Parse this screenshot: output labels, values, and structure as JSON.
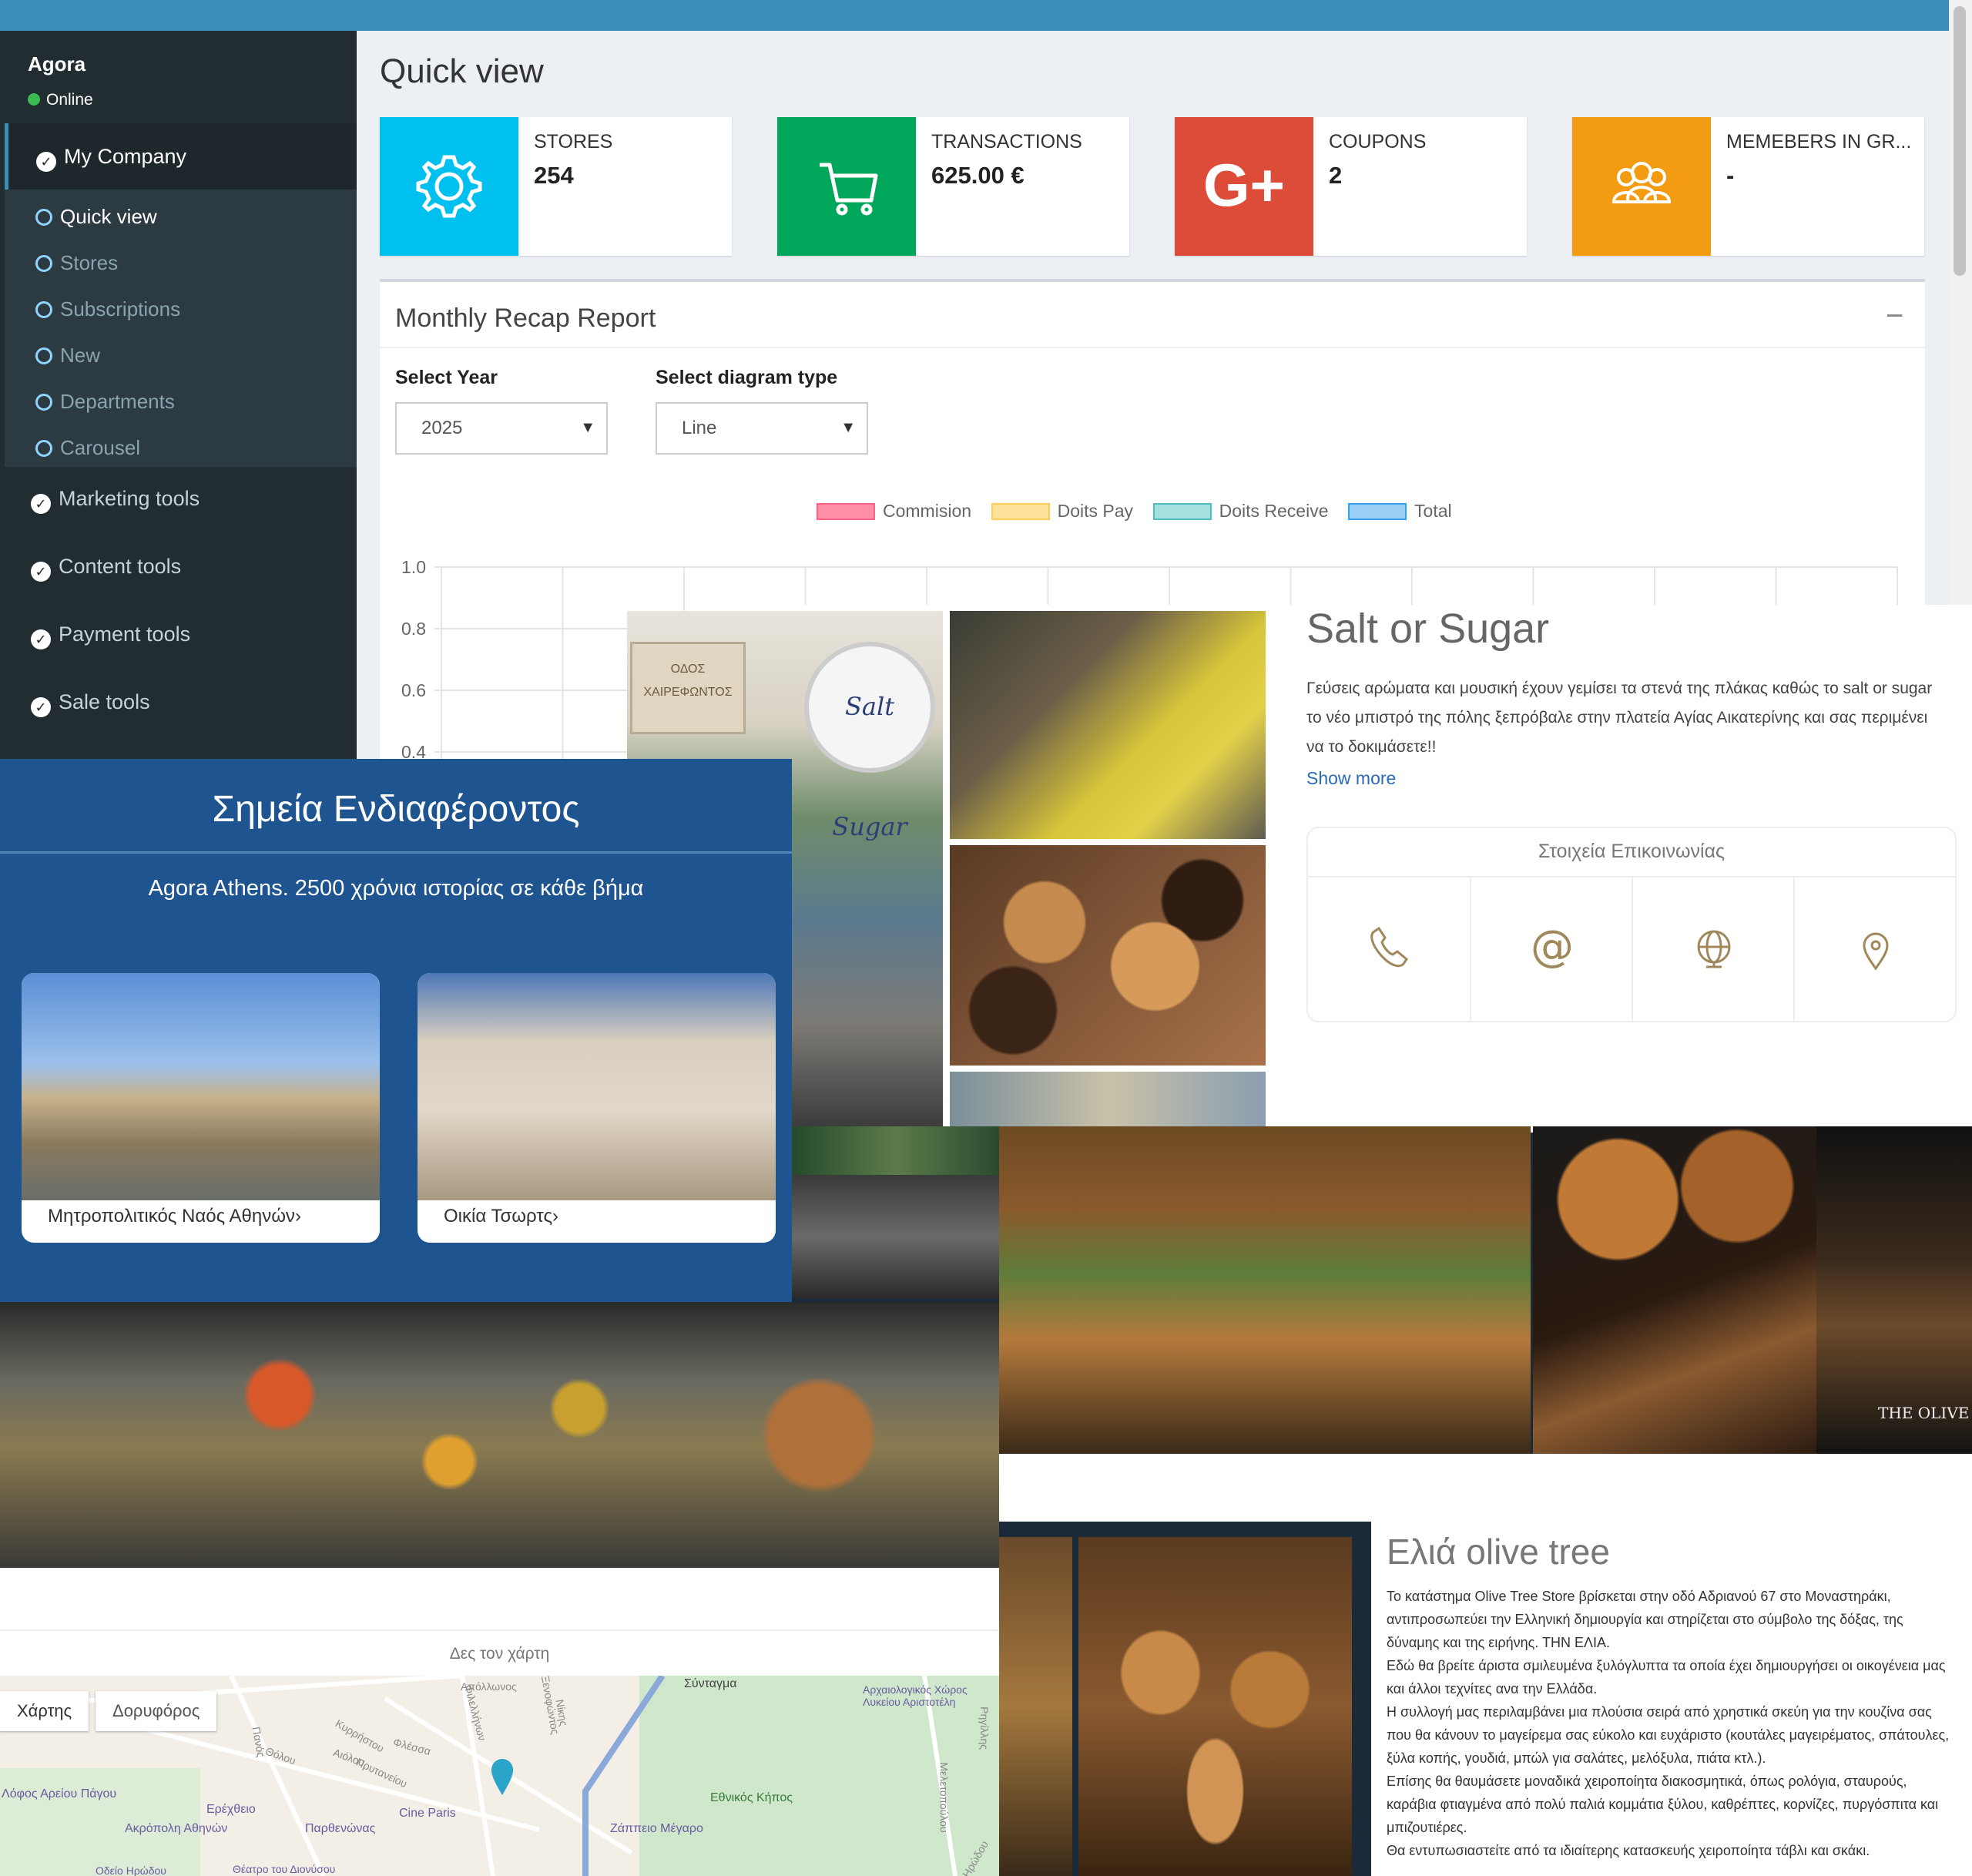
{
  "sidebar": {
    "brand": "Agora",
    "status": "Online",
    "active_item": "My Company",
    "sub_items": [
      "Quick view",
      "Stores",
      "Subscriptions",
      "New",
      "Departments",
      "Carousel"
    ],
    "tools": [
      "Marketing tools",
      "Content tools",
      "Payment tools",
      "Sale tools"
    ]
  },
  "dashboard": {
    "title": "Quick view",
    "boxes": [
      {
        "label": "STORES",
        "value": "254",
        "color": "#00c0ef",
        "icon": "gear-icon"
      },
      {
        "label": "TRANSACTIONS",
        "value": "625.00 €",
        "color": "#00a65a",
        "icon": "cart-icon"
      },
      {
        "label": "COUPONS",
        "value": "2",
        "color": "#dd4b39",
        "icon": "google-plus-icon"
      },
      {
        "label": "MEMEBERS IN GR...",
        "value": "-",
        "color": "#f39c12",
        "icon": "users-icon"
      }
    ],
    "report": {
      "title": "Monthly Recap Report",
      "year_label": "Select Year",
      "year_value": "2025",
      "type_label": "Select diagram type",
      "type_value": "Line"
    }
  },
  "chart_data": {
    "type": "line",
    "series": [
      {
        "name": "Commision",
        "color": "#ff6384",
        "values": []
      },
      {
        "name": "Doits Pay",
        "color": "#ffcd56",
        "values": []
      },
      {
        "name": "Doits Receive",
        "color": "#4bc0c0",
        "values": []
      },
      {
        "name": "Total",
        "color": "#36a2eb",
        "values": []
      }
    ],
    "yticks": [
      "1.0",
      "0.8",
      "0.6",
      "0.4"
    ],
    "ylim": [
      0,
      1.0
    ]
  },
  "salt": {
    "title": "Salt or Sugar",
    "description": "Γεύσεις αρώματα και μουσική έχουν γεμίσει τα στενά της πλάκας καθώς το salt or sugar το νέο μπιστρό της πόλης ξεπρόβαλε στην πλατεία Αγίας Αικατερίνης και σας περιμένει να το δοκιμάσετε!!",
    "show_more": "Show more",
    "contact_title": "Στοιχεία Επικοινωνίας",
    "contact_icons": [
      "phone-icon",
      "at-icon",
      "globe-icon",
      "location-pin-icon"
    ],
    "sign_text": "ΟΔΟΣ ΧΑΙΡΕΦΩΝΤΟΣ",
    "logo_text": "Salt Sugar"
  },
  "poi": {
    "title": "Σημεία Ενδιαφέροντος",
    "subtitle": "Agora Athens. 2500 χρόνια ιστορίας σε κάθε βήμα",
    "cards": [
      "Μητροπολιτικός Ναός Αθηνών",
      "Οικία Τσωρτς"
    ]
  },
  "olive": {
    "title": "Ελιά olive tree",
    "paragraphs": [
      "Το κατάστημα Olive Tree Store βρίσκεται στην οδό Αδριανού 67 στο Μοναστηράκι, αντιπροσωπεύει την Ελληνική δημιουργία και στηρίζεται στο σύμβολο της δόξας, της δύναμης και της ειρήνης. ΤΗΝ ΕΛΙΑ.",
      "Εδώ θα βρείτε άριστα σμιλευμένα ξυλόγλυπτα τα οποία έχει δημιουργήσει οι οικογένεια μας και άλλοι τεχνίτες ανα την Ελλάδα.",
      "Η συλλογή μας περιλαμβάνει μια πλούσια σειρά από χρηστικά σκεύη για την κουζίνα σας που θα κάνουν το μαγείρεμα σας εύκολο και ευχάριστο (κουτάλες μαγειρέματος, σπάτουλες, ξύλα κοπής, γουδιά, μπώλ για σαλάτες, μελόξυλα, πιάτα κτλ.).",
      "Επίσης θα θαυμάσετε μοναδικά χειροποίητα διακοσμητικά, όπως ρολόγια, σταυρούς, καράβια φτιαγμένα από πολύ παλιά κομμάτια ξύλου, καθρέπτες, κορνίζες, πυργόσπιτα και μπιζουτιέρες.",
      "Θα εντυπωσιαστείτε από τα ιδιαίτερης κατασκευής χειροποίητα τάβλι και σκάκι."
    ],
    "store_brand": "THE OLIVE"
  },
  "map": {
    "link": "Δες τον χάρτη",
    "tabs": [
      "Χάρτης",
      "Δορυφόρος"
    ],
    "labels": [
      "Λόφος Αρείου Πάγου",
      "Ερέχθειο",
      "Ακρόπολη Αθηνών",
      "Παρθενώνας",
      "Cine Paris",
      "Ζάππειο Μέγαρο",
      "Εθνικός Κήπος",
      "Σύνταγμα",
      "Αρχαιολογικός Χώρος Λυκείου Αριστοτέλη",
      "Θέατρο του Διονύσου",
      "Οδείο Ηρώδου"
    ],
    "streets": [
      "Πανός",
      "Θόλου",
      "Κυρρήστου",
      "Αιόλου",
      "Πρυτανείου",
      "Φλέσσα",
      "Απόλλωνος",
      "Φιλελλήνων",
      "Νίκης",
      "Ξενοφώντος",
      "Ρηγίλλης",
      "Μελετοπούλου",
      "Ηρώδου"
    ]
  }
}
